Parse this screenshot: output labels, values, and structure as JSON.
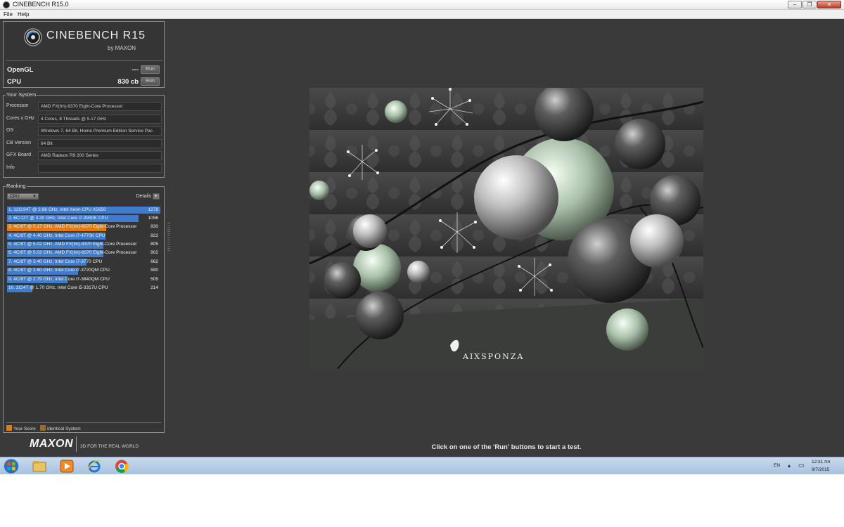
{
  "window": {
    "title": "CINEBENCH R15.0",
    "buttons": [
      "–",
      "❐",
      "✕"
    ]
  },
  "menu": {
    "items": [
      "File",
      "Help"
    ]
  },
  "logo": {
    "name": "CINEBENCH R15",
    "by": "by MAXON"
  },
  "benchmarks": [
    {
      "label": "OpenGL",
      "score": "---",
      "button": "Run"
    },
    {
      "label": "CPU",
      "score": "830 cb",
      "button": "Run"
    }
  ],
  "your_system": {
    "title": "Your System",
    "rows": [
      {
        "key": "Processor",
        "value": "AMD FX(tm)-9370 Eight-Core Processor"
      },
      {
        "key": "Cores x GHz",
        "value": "4 Cores, 8 Threads @ 5.17 GHz"
      },
      {
        "key": "OS",
        "value": "Windows 7, 64 Bit, Home Premium Edition Service Pac"
      },
      {
        "key": "CB Version",
        "value": "64 Bit"
      },
      {
        "key": "GFX Board",
        "value": "AMD Radeon R9 200 Series"
      },
      {
        "key": "Info",
        "value": ""
      }
    ]
  },
  "ranking": {
    "title": "Ranking",
    "selected": "CPU",
    "details_label": "Details",
    "max_score": 1279,
    "rows": [
      {
        "label": "1. 12C/24T @ 2.66 GHz, Intel Xeon CPU X5650",
        "score": 1279,
        "yours": false
      },
      {
        "label": "2. 6C/12T @ 3.30 GHz,  Intel Core i7-3930K CPU",
        "score": 1096,
        "yours": false
      },
      {
        "label": "3. 4C/8T @ 5.17 GHz, AMD FX(tm)-9370 Eight-Core Processor",
        "score": 830,
        "yours": true
      },
      {
        "label": "4. 4C/8T @ 4.40 GHz, Intel Core i7-4770K CPU",
        "score": 822,
        "yours": false
      },
      {
        "label": "5. 4C/8T @ 5.02 GHz, AMD FX(tm)-9370 Eight-Core Processor",
        "score": 805,
        "yours": false
      },
      {
        "label": "6. 4C/8T @ 5.02 GHz, AMD FX(tm)-9370 Eight-Core Processor",
        "score": 802,
        "yours": false
      },
      {
        "label": "7. 4C/8T @ 3.40 GHz,  Intel Core i7-3770 CPU",
        "score": 662,
        "yours": false
      },
      {
        "label": "8. 4C/8T @ 2.60 GHz, Intel Core i7-3720QM CPU",
        "score": 590,
        "yours": false
      },
      {
        "label": "9. 4C/8T @ 2.79 GHz,  Intel Core i7-3840QM CPU",
        "score": 505,
        "yours": false
      },
      {
        "label": "10. 2C/4T @ 1.70 GHz,  Intel Core i5-3317U CPU",
        "score": 214,
        "yours": false
      }
    ],
    "legend": [
      {
        "label": "Your Score",
        "color": "#e07b12"
      },
      {
        "label": "Identical System",
        "color": "#9a6a2e"
      }
    ]
  },
  "footer": {
    "brand": "MAXON",
    "tagline": "3D FOR THE REAL WORLD"
  },
  "status_message": "Click on one of the 'Run' buttons to start a test.",
  "render": {
    "watermark": "AIXSPONZA"
  },
  "taskbar": {
    "apps": [
      "windows-explorer",
      "media-player",
      "internet-explorer",
      "chrome"
    ],
    "language": "EN",
    "time": "12:31 אח",
    "date": "9/7/2015"
  },
  "colors": {
    "background": "#3a3a3a",
    "bar": "#3f7ccc",
    "your_score": "#e07b12"
  }
}
